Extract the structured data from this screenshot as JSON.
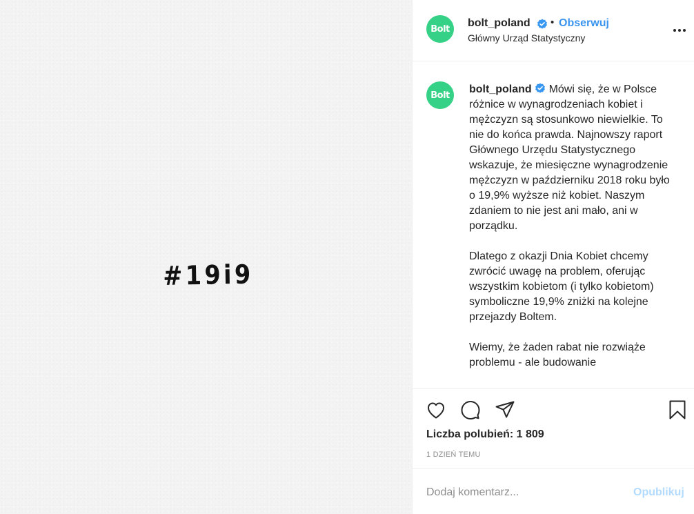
{
  "media": {
    "hashtag_text": "#19i9",
    "background_color": "#f3f3f3"
  },
  "header": {
    "avatar_text": "Bolt",
    "avatar_color": "#34d186",
    "username": "bolt_poland",
    "verified_icon": "verified-badge-icon",
    "separator": "•",
    "follow_label": "Obserwuj",
    "location": "Główny Urząd Statystyczny",
    "more_icon": "more-options-icon"
  },
  "caption": {
    "avatar_text": "Bolt",
    "username": "bolt_poland",
    "paragraphs": [
      "Mówi się, że w Polsce różnice w wynagrodzeniach kobiet i mężczyzn są stosunkowo niewielkie. To nie do końca prawda. Najnowszy raport Głównego Urzędu Statystycznego wskazuje, że miesięczne wynagrodzenie mężczyzn w październiku 2018 roku było o 19,9% wyższe niż kobiet. Naszym zdaniem to nie jest ani mało, ani w porządku.",
      "Dlatego z okazji Dnia Kobiet chcemy zwrócić uwagę na problem, oferując wszystkim kobietom (i tylko kobietom) symboliczne 19,9% zniżki na kolejne przejazdy Boltem.",
      "Wiemy, że żaden rabat nie rozwiąże problemu - ale budowanie"
    ]
  },
  "actions": {
    "like_icon": "heart-icon",
    "comment_icon": "comment-bubble-icon",
    "share_icon": "paper-plane-icon",
    "save_icon": "bookmark-icon",
    "likes_text": "Liczba polubień: 1 809",
    "timestamp": "1 DZIEŃ TEMU"
  },
  "comment": {
    "placeholder": "Dodaj komentarz...",
    "publish_label": "Opublikuj"
  },
  "colors": {
    "accent_blue": "#3b95f0",
    "publish_disabled": "#b3dbff",
    "brand_green": "#34d186",
    "muted_text": "#8e8e8e"
  }
}
